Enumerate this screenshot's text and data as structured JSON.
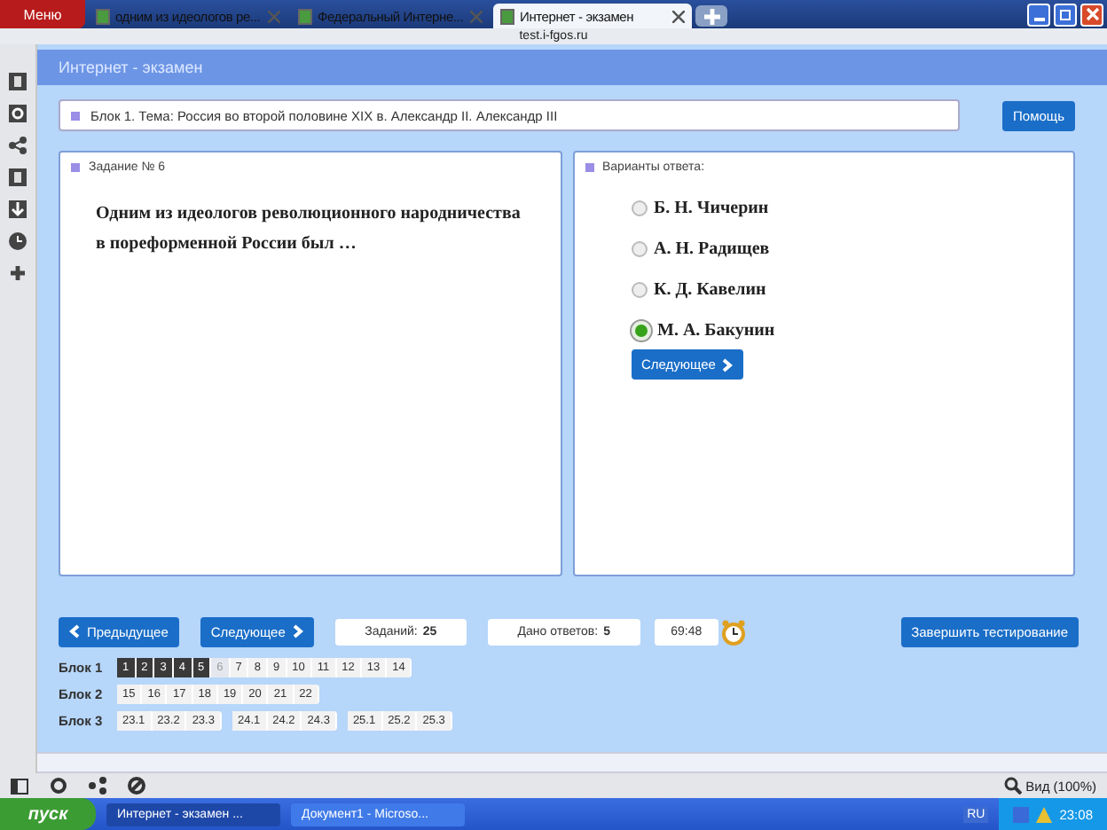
{
  "browser": {
    "menu_label": "Меню",
    "tabs": [
      {
        "title": "одним из идеологов ре...",
        "selected": false
      },
      {
        "title": "Федеральный Интерне...",
        "selected": false
      },
      {
        "title": "Интернет - экзамен",
        "selected": true
      }
    ],
    "address": "test.i-fgos.ru"
  },
  "page_title": "Интернет - экзамен",
  "topic": "Блок 1. Тема: Россия во второй половине XIX в. Александр II. Александр III",
  "help_button": "Помощь",
  "task": {
    "heading": "Задание № 6",
    "question": "Одним из идеологов революционного народничества в пореформенной России был …"
  },
  "answers": {
    "heading": "Варианты ответа:",
    "options": [
      {
        "label": "Б. Н. Чичерин",
        "selected": false
      },
      {
        "label": "А. Н. Радищев",
        "selected": false
      },
      {
        "label": "К. Д. Кавелин",
        "selected": false
      },
      {
        "label": "М. А. Бакунин",
        "selected": true
      }
    ],
    "next_button": "Следующее"
  },
  "nav": {
    "prev_button": "Предыдущее",
    "next_button": "Следующее",
    "tasks_label": "Заданий:",
    "tasks_count": "25",
    "answered_label": "Дано ответов:",
    "answered_count": "5",
    "timer": "69:48",
    "finish_button": "Завершить тестирование"
  },
  "blocks": [
    {
      "label": "Блок 1",
      "groups": [
        [
          {
            "n": "1",
            "answered": true,
            "selected": false
          },
          {
            "n": "2",
            "answered": true,
            "selected": false
          },
          {
            "n": "3",
            "answered": true,
            "selected": false
          },
          {
            "n": "4",
            "answered": true,
            "selected": false
          },
          {
            "n": "5",
            "answered": true,
            "selected": false
          },
          {
            "n": "6",
            "answered": false,
            "selected": true
          },
          {
            "n": "7",
            "answered": false,
            "selected": false
          },
          {
            "n": "8",
            "answered": false,
            "selected": false
          },
          {
            "n": "9",
            "answered": false,
            "selected": false
          },
          {
            "n": "10",
            "answered": false,
            "selected": false
          },
          {
            "n": "11",
            "answered": false,
            "selected": false
          },
          {
            "n": "12",
            "answered": false,
            "selected": false
          },
          {
            "n": "13",
            "answered": false,
            "selected": false
          },
          {
            "n": "14",
            "answered": false,
            "selected": false
          }
        ]
      ]
    },
    {
      "label": "Блок 2",
      "groups": [
        [
          {
            "n": "15",
            "answered": false,
            "selected": false
          },
          {
            "n": "16",
            "answered": false,
            "selected": false
          },
          {
            "n": "17",
            "answered": false,
            "selected": false
          },
          {
            "n": "18",
            "answered": false,
            "selected": false
          },
          {
            "n": "19",
            "answered": false,
            "selected": false
          },
          {
            "n": "20",
            "answered": false,
            "selected": false
          },
          {
            "n": "21",
            "answered": false,
            "selected": false
          },
          {
            "n": "22",
            "answered": false,
            "selected": false
          }
        ]
      ]
    },
    {
      "label": "Блок 3",
      "groups": [
        [
          {
            "n": "23.1",
            "answered": false,
            "selected": false
          },
          {
            "n": "23.2",
            "answered": false,
            "selected": false
          },
          {
            "n": "23.3",
            "answered": false,
            "selected": false
          }
        ],
        [
          {
            "n": "24.1",
            "answered": false,
            "selected": false
          },
          {
            "n": "24.2",
            "answered": false,
            "selected": false
          },
          {
            "n": "24.3",
            "answered": false,
            "selected": false
          }
        ],
        [
          {
            "n": "25.1",
            "answered": false,
            "selected": false
          },
          {
            "n": "25.2",
            "answered": false,
            "selected": false
          },
          {
            "n": "25.3",
            "answered": false,
            "selected": false
          }
        ]
      ]
    }
  ],
  "status_bar": {
    "zoom": "Вид (100%)"
  },
  "taskbar": {
    "start": "пуск",
    "windows": [
      {
        "title": "Интернет - экзамен ...",
        "selected": true
      },
      {
        "title": "Документ1 - Microso...",
        "selected": false
      }
    ],
    "lang": "RU",
    "clock": "23:08"
  }
}
